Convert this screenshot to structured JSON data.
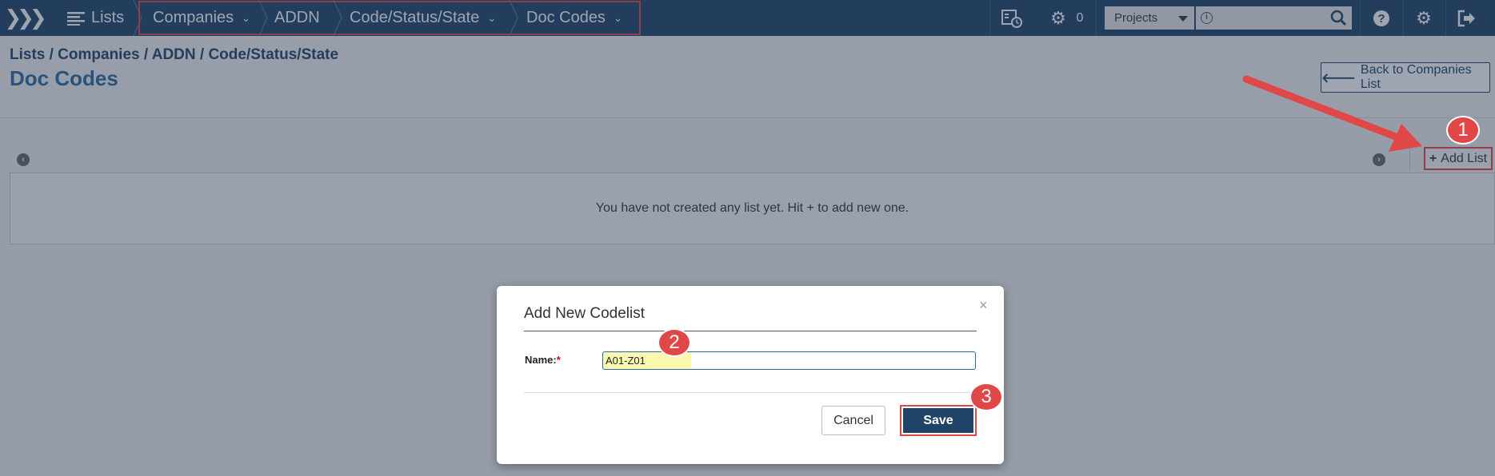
{
  "topbar": {
    "lists_label": "Lists",
    "crumbs": [
      "Companies",
      "ADDN",
      "Code/Status/State",
      "Doc Codes"
    ],
    "jobs_count": "0",
    "project_select": "Projects"
  },
  "header": {
    "breadcrumb": "Lists / Companies / ADDN / Code/Status/State",
    "title": "Doc Codes",
    "back_button": "Back to Companies List"
  },
  "list_area": {
    "add_list_label": "Add List",
    "empty_message": "You have not created any list yet. Hit + to add new one."
  },
  "modal": {
    "title": "Add New Codelist",
    "close_symbol": "×",
    "name_label": "Name:",
    "required_mark": "*",
    "name_value": "A01-Z01",
    "cancel_label": "Cancel",
    "save_label": "Save"
  },
  "annotations": {
    "step1": "1",
    "step2": "2",
    "step3": "3"
  },
  "colors": {
    "nav_bg": "#1f4468",
    "accent_red": "#e04848",
    "title_blue": "#2a6aa3"
  }
}
